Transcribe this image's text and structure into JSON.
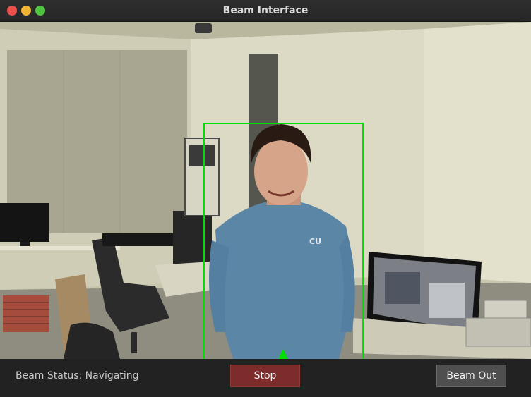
{
  "window": {
    "title": "Beam Interface"
  },
  "camera": {
    "shirt_logo": "CU"
  },
  "bottom_bar": {
    "status_label": "Beam Status:",
    "status_value": "Navigating",
    "stop_label": "Stop",
    "beam_out_label": "Beam Out"
  },
  "colors": {
    "tracking_box": "#00e000",
    "stop_button": "#7e2b2b",
    "beam_out_button": "#4f4f4f"
  }
}
